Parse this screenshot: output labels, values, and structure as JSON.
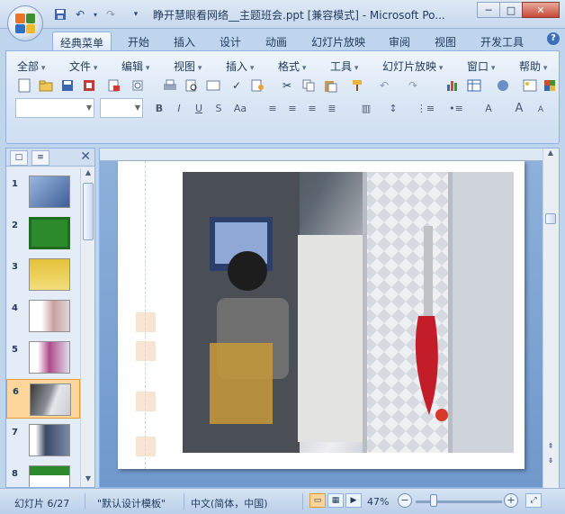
{
  "window": {
    "title": "睁开慧眼看网络__主题班会.ppt [兼容模式] - Microsoft Po...",
    "minimize": "─",
    "maximize": "□",
    "close": "✕"
  },
  "quick_access": {
    "save_icon": "save-icon",
    "undo_icon": "undo-icon",
    "redo_icon": "redo-icon",
    "customize_icon": "customize-icon"
  },
  "tabs": [
    "经典菜单",
    "开始",
    "插入",
    "设计",
    "动画",
    "幻灯片放映",
    "审阅",
    "视图",
    "开发工具"
  ],
  "active_tab": "经典菜单",
  "help": "?",
  "classic_menu": [
    "全部",
    "文件",
    "编辑",
    "视图",
    "插入",
    "格式",
    "工具",
    "幻灯片放映",
    "窗口",
    "帮助"
  ],
  "format_buttons": [
    "B",
    "I",
    "U",
    "S",
    "Aa",
    "A",
    "A",
    "A"
  ],
  "left_panel": {
    "tab_slides": "□",
    "tab_outline": "≡",
    "close": "✕",
    "slides": [
      {
        "number": "1",
        "bg": "#5b7fb3"
      },
      {
        "number": "2",
        "bg": "#2c8a2c"
      },
      {
        "number": "3",
        "bg": "#e4c23a"
      },
      {
        "number": "4",
        "bg": "#e8e0e0"
      },
      {
        "number": "5",
        "bg": "#f4f4f4"
      },
      {
        "number": "6",
        "bg": "#d8d8d8"
      },
      {
        "number": "7",
        "bg": "#f2f2f2"
      },
      {
        "number": "8",
        "bg": "#f4f4f4"
      }
    ],
    "selected_slide": "6"
  },
  "status": {
    "slide_info": "幻灯片 6/27",
    "template": "\"默认设计模板\"",
    "language": "中文(简体，中国)",
    "zoom": "47%",
    "zoom_fraction": 0.47
  },
  "colors": {
    "accent": "#3d6fb9",
    "selected": "#fcd69a",
    "ribbon_border": "#8db2e3"
  }
}
